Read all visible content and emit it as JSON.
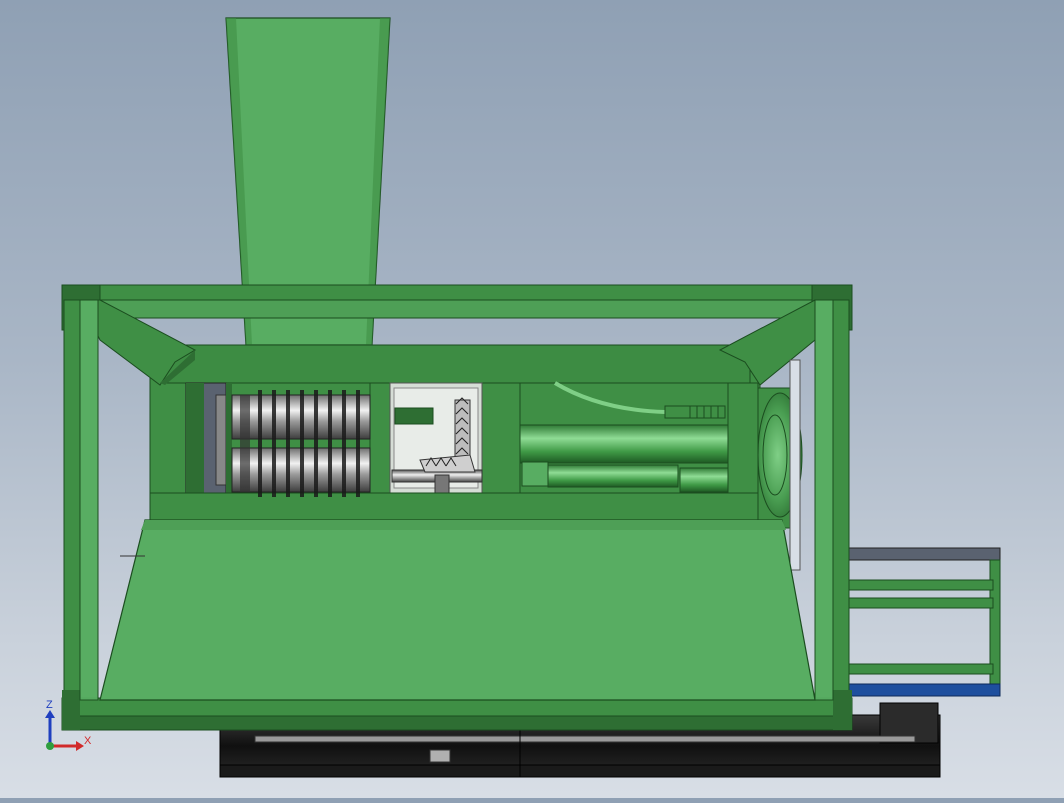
{
  "viewport": {
    "background_top": "#8fa0b4",
    "background_bottom": "#d8dee6"
  },
  "model": {
    "frame_color": "#3f8f45",
    "panel_color": "#58ad62",
    "dark_green": "#2e6e33",
    "base_color": "#1e1e1e",
    "conveyor_color": "#5a6270",
    "belt_blue": "#1e4f9e"
  },
  "triad": {
    "z_label": "Z",
    "x_label": "X",
    "z_color": "#1f3fbf",
    "x_color": "#d12a2a",
    "origin_color": "#2e9e3e"
  }
}
